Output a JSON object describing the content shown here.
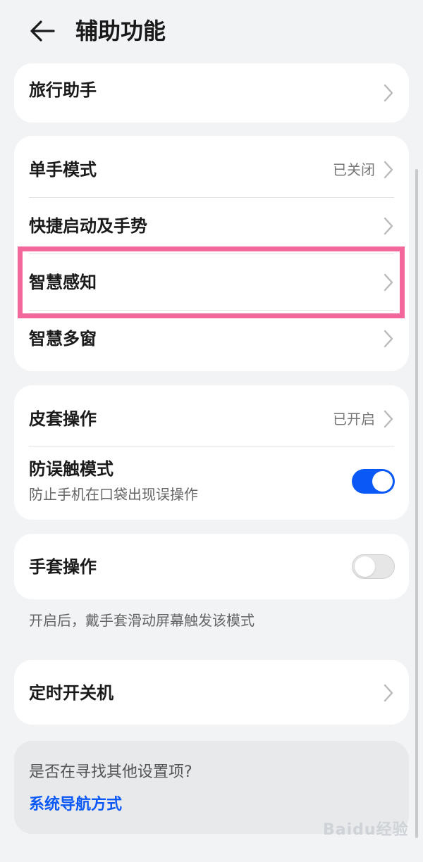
{
  "header": {
    "title": "辅助功能"
  },
  "groups": {
    "g1": {
      "travel": {
        "label": "旅行助手"
      }
    },
    "g2": {
      "one_hand": {
        "label": "单手模式",
        "value": "已关闭"
      },
      "shortcuts": {
        "label": "快捷启动及手势"
      },
      "smart_sense": {
        "label": "智慧感知"
      },
      "multi_window": {
        "label": "智慧多窗"
      }
    },
    "g3": {
      "cover": {
        "label": "皮套操作",
        "value": "已开启"
      },
      "anti_touch": {
        "label": "防误触模式",
        "sublabel": "防止手机在口袋出现误操作",
        "toggle_on": true
      }
    },
    "g4": {
      "glove": {
        "label": "手套操作",
        "toggle_on": false
      },
      "glove_note": "开启后，戴手套滑动屏幕触发该模式"
    },
    "g5": {
      "timer": {
        "label": "定时开关机"
      }
    }
  },
  "search": {
    "question": "是否在寻找其他设置项?",
    "link": "系统导航方式"
  },
  "watermark": "Baidu经验",
  "colors": {
    "background": "#f1f3f5",
    "accent": "#0a59f7",
    "highlight": "#f2689a"
  }
}
